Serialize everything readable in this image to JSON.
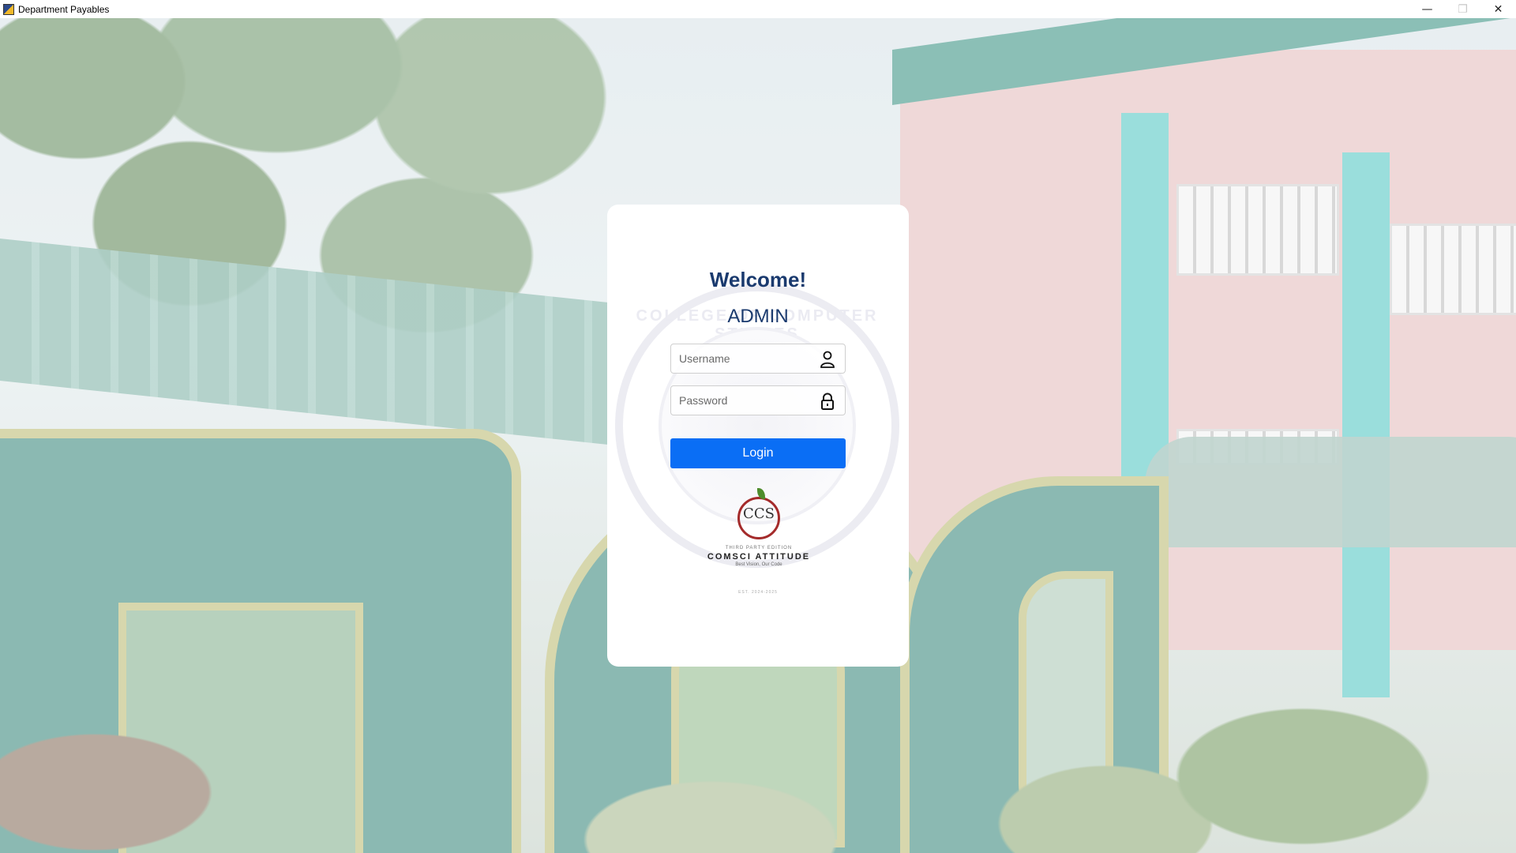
{
  "window": {
    "title": "Department Payables",
    "controls": {
      "minimize": "—",
      "maximize": "❐",
      "close": "✕"
    }
  },
  "background": {
    "description_icon": "campus-photo"
  },
  "login": {
    "welcome": "Welcome!",
    "role": "ADMIN",
    "username_placeholder": "Username",
    "password_placeholder": "Password",
    "login_label": "Login",
    "accent_color": "#0a6ef5",
    "title_color": "#1a3a6e",
    "seal_text": "COLLEGE OF COMPUTER STUDIES"
  },
  "logo": {
    "monogram": "CCS",
    "tagline": "THIRD PARTY EDITION",
    "name": "COMSCI ATTITUDE",
    "subline": "Best Vision, Our Code",
    "est": "EST. 2024-2025"
  }
}
